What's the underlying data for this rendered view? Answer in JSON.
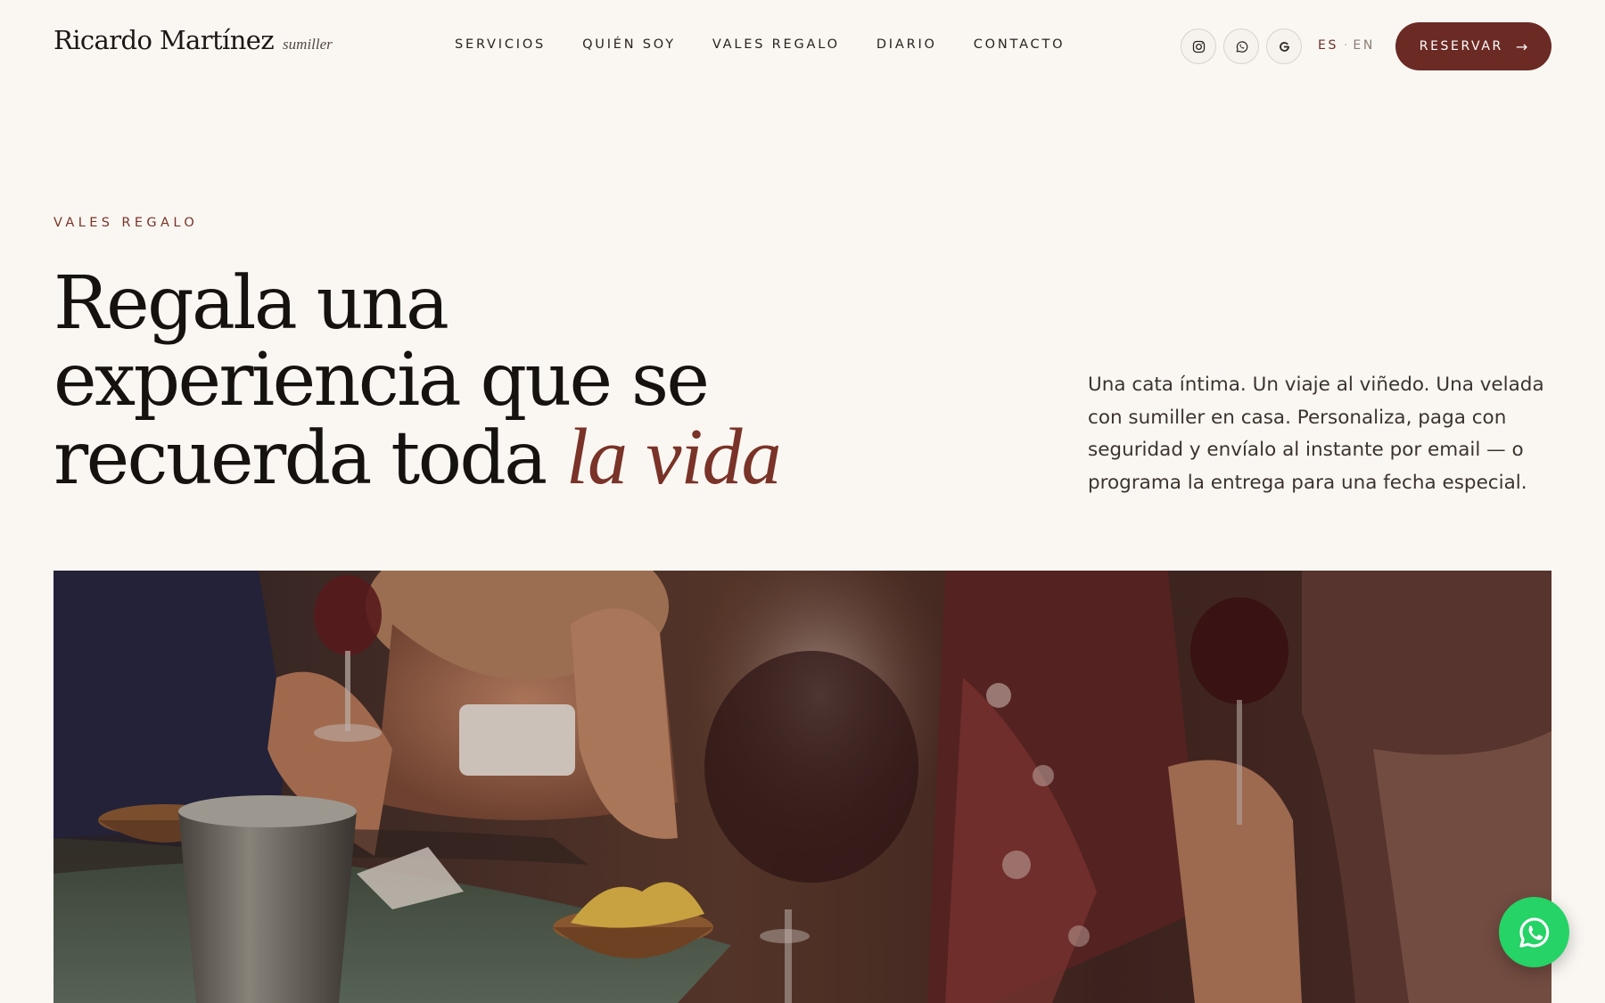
{
  "brand": {
    "name": "Ricardo Martínez",
    "tagline": "sumiller"
  },
  "nav": {
    "items": [
      {
        "label": "SERVICIOS"
      },
      {
        "label": "QUIÉN SOY"
      },
      {
        "label": "VALES REGALO"
      },
      {
        "label": "DIARIO"
      },
      {
        "label": "CONTACTO"
      }
    ]
  },
  "socials": [
    {
      "icon": "instagram-icon"
    },
    {
      "icon": "whatsapp-icon"
    },
    {
      "icon": "google-icon"
    }
  ],
  "language": {
    "active": "ES",
    "separator": "·",
    "other": "EN"
  },
  "cta": {
    "label": "RESERVAR",
    "arrow": "→"
  },
  "hero": {
    "eyebrow": "VALES REGALO",
    "headline_line1": "Regala una",
    "headline_line2": "experiencia que se",
    "headline_line3_plain": "recuerda toda",
    "headline_line3_accent": "la vida",
    "lede": "Una cata íntima. Un viaje al viñedo. Una velada con sumiller en casa. Personaliza, paga con seguridad y envíalo al instante por email — o programa la entrega para una fecha especial."
  },
  "photo": {
    "subject": "wine-tasting-photo"
  },
  "floating_button": {
    "icon": "whatsapp-icon"
  },
  "colors": {
    "background": "#faf7f3",
    "accent": "#7a3328",
    "cta": "#6b2a24",
    "whatsapp": "#25d366",
    "text": "#161210"
  }
}
